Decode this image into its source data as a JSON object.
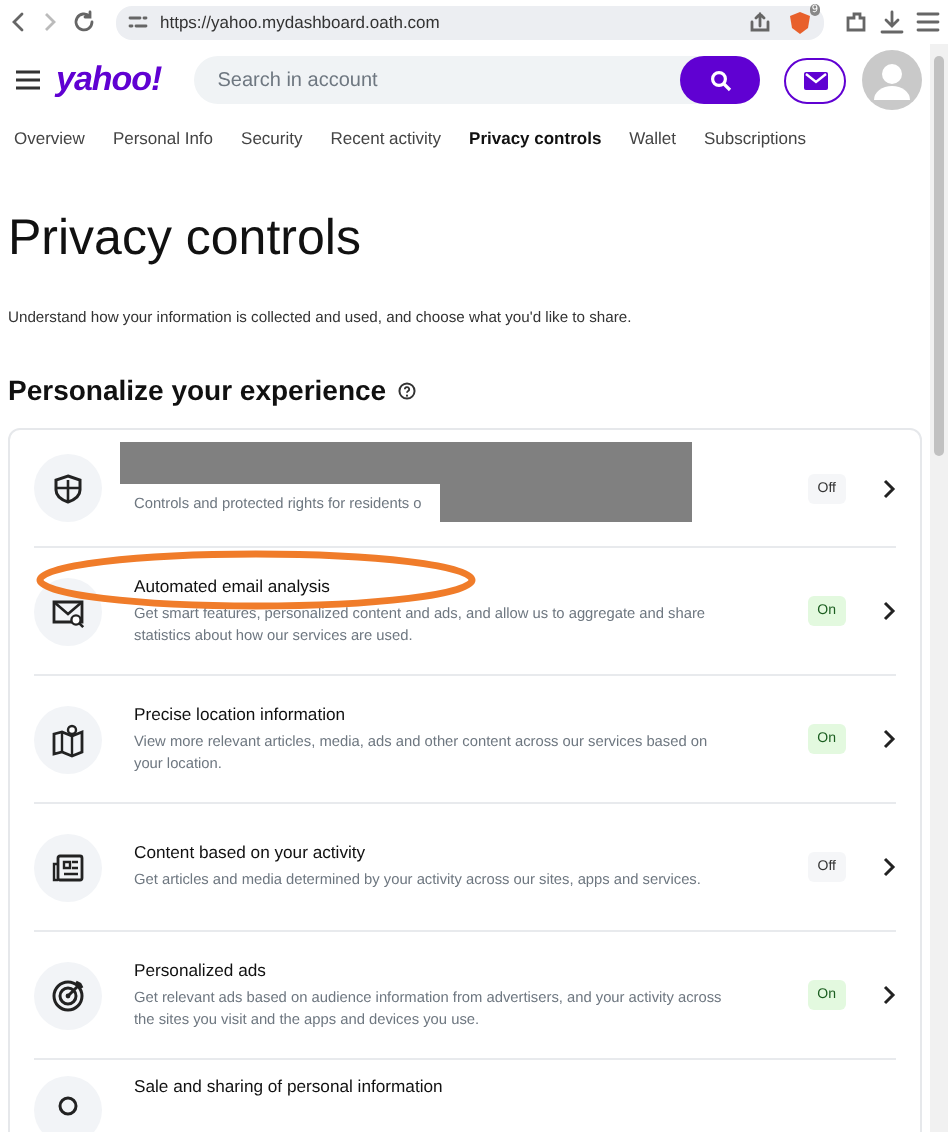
{
  "browser": {
    "url": "https://yahoo.mydashboard.oath.com",
    "badge": "9"
  },
  "header": {
    "logo": "yahoo!",
    "search": {
      "placeholder": "Search in account"
    }
  },
  "tabs": [
    {
      "label": "Overview",
      "selected": false
    },
    {
      "label": "Personal Info",
      "selected": false
    },
    {
      "label": "Security",
      "selected": false
    },
    {
      "label": "Recent activity",
      "selected": false
    },
    {
      "label": "Privacy controls",
      "selected": true
    },
    {
      "label": "Wallet",
      "selected": false
    },
    {
      "label": "Subscriptions",
      "selected": false
    }
  ],
  "page": {
    "title": "Privacy controls",
    "intro": "Understand how your information is collected and used, and choose what you'd like to share.",
    "section": "Personalize your experience"
  },
  "settings": [
    {
      "redacted": true,
      "highlighted": false,
      "description": "Controls and protected rights for residents o",
      "status": "Off",
      "on": false
    },
    {
      "redacted": false,
      "highlighted": true,
      "title": "Automated email analysis",
      "description": "Get smart features, personalized content and ads, and allow us to aggregate and share statistics about how our services are used.",
      "status": "On",
      "on": true
    },
    {
      "redacted": false,
      "highlighted": false,
      "title": "Precise location information",
      "description": "View more relevant articles, media, ads and other content across our services based on your location.",
      "status": "On",
      "on": true
    },
    {
      "redacted": false,
      "highlighted": false,
      "title": "Content based on your activity",
      "description": "Get articles and media determined by your activity across our sites, apps and services.",
      "status": "Off",
      "on": false
    },
    {
      "redacted": false,
      "highlighted": false,
      "title": "Personalized ads",
      "description": "Get relevant ads based on audience information from advertisers, and your activity across the sites you visit and the apps and devices you use.",
      "status": "On",
      "on": true
    },
    {
      "redacted": false,
      "highlighted": false,
      "title": "Sale and sharing of personal information"
    }
  ]
}
